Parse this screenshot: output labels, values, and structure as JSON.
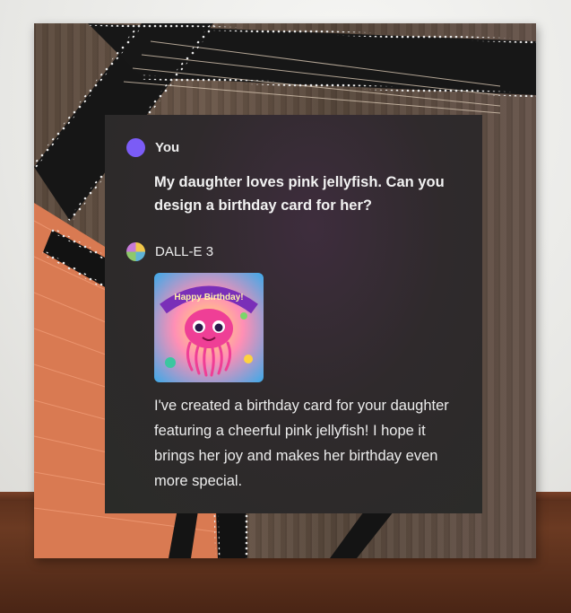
{
  "conversation": {
    "user": {
      "name": "You",
      "message": "My daughter loves pink jellyfish. Can you design a birthday card for her?"
    },
    "assistant": {
      "name": "DALL-E 3",
      "image_caption_text": "Happy Birthday!",
      "message": "I've created a birthday card for your daughter featuring a cheerful pink jellyfish! I hope it brings her joy and makes her birthday even more special."
    }
  },
  "colors": {
    "user_avatar": "#7b5cf6",
    "chat_background": "#2a2b28",
    "text": "#ececec"
  }
}
